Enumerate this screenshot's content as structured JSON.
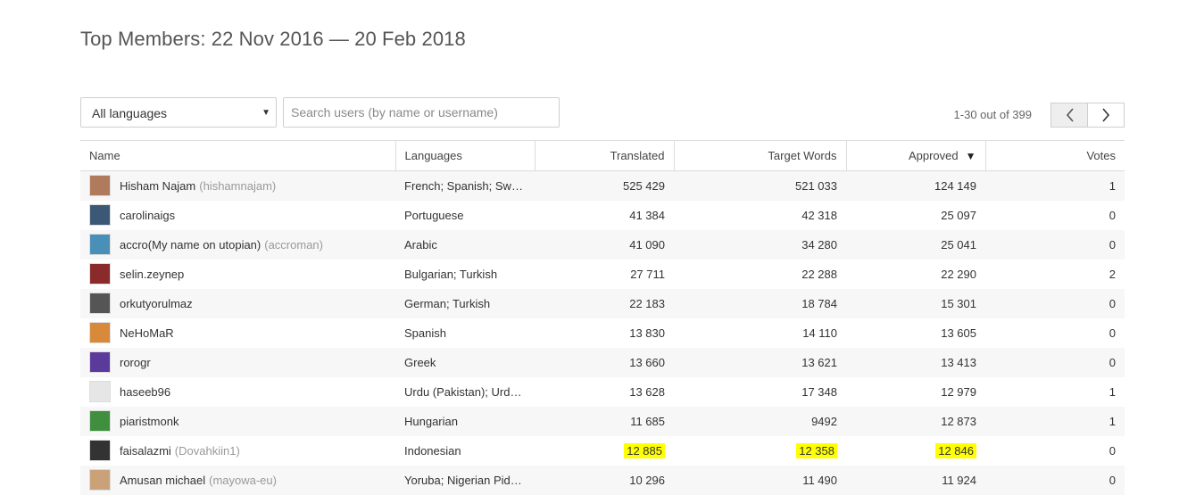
{
  "page": {
    "title": "Top Members: 22 Nov 2016 — 20 Feb 2018"
  },
  "filters": {
    "language_select_value": "All languages",
    "search_placeholder": "Search users (by name or username)"
  },
  "pagination": {
    "count_text": "1-30 out of 399"
  },
  "table": {
    "headers": {
      "name": "Name",
      "languages": "Languages",
      "translated": "Translated",
      "target_words": "Target Words",
      "approved": "Approved",
      "votes": "Votes"
    },
    "sort_indicator": "▼",
    "rows": [
      {
        "name": "Hisham Najam",
        "username": "(hishamnajam)",
        "languages": "French; Spanish; Sw…",
        "translated": "525 429",
        "target_words": "521 033",
        "approved": "124 149",
        "votes": "1",
        "avatar_color": "#b07a5c"
      },
      {
        "name": "carolinaigs",
        "username": "",
        "languages": "Portuguese",
        "translated": "41 384",
        "target_words": "42 318",
        "approved": "25 097",
        "votes": "0",
        "avatar_color": "#3b5876"
      },
      {
        "name": "accro(My name on utopian)",
        "username": "(accroman)",
        "languages": "Arabic",
        "translated": "41 090",
        "target_words": "34 280",
        "approved": "25 041",
        "votes": "0",
        "avatar_color": "#4a8fb8"
      },
      {
        "name": "selin.zeynep",
        "username": "",
        "languages": "Bulgarian; Turkish",
        "translated": "27 711",
        "target_words": "22 288",
        "approved": "22 290",
        "votes": "2",
        "avatar_color": "#8a2a2a"
      },
      {
        "name": "orkutyorulmaz",
        "username": "",
        "languages": "German; Turkish",
        "translated": "22 183",
        "target_words": "18 784",
        "approved": "15 301",
        "votes": "0",
        "avatar_color": "#555555"
      },
      {
        "name": "NeHoMaR",
        "username": "",
        "languages": "Spanish",
        "translated": "13 830",
        "target_words": "14 110",
        "approved": "13 605",
        "votes": "0",
        "avatar_color": "#d88a3a"
      },
      {
        "name": "rorogr",
        "username": "",
        "languages": "Greek",
        "translated": "13 660",
        "target_words": "13 621",
        "approved": "13 413",
        "votes": "0",
        "avatar_color": "#5a3a9a"
      },
      {
        "name": "haseeb96",
        "username": "",
        "languages": "Urdu (Pakistan); Urd…",
        "translated": "13 628",
        "target_words": "17 348",
        "approved": "12 979",
        "votes": "1",
        "avatar_color": "#e6e6e6"
      },
      {
        "name": "piaristmonk",
        "username": "",
        "languages": "Hungarian",
        "translated": "11 685",
        "target_words": "9492",
        "approved": "12 873",
        "votes": "1",
        "avatar_color": "#3f8f3f"
      },
      {
        "name": "faisalazmi",
        "username": "(Dovahkiin1)",
        "languages": "Indonesian",
        "translated": "12 885",
        "target_words": "12 358",
        "approved": "12 846",
        "votes": "0",
        "avatar_color": "#333333",
        "highlight": true
      },
      {
        "name": "Amusan michael",
        "username": "(mayowa-eu)",
        "languages": "Yoruba; Nigerian Pid…",
        "translated": "10 296",
        "target_words": "11 490",
        "approved": "11 924",
        "votes": "0",
        "avatar_color": "#c9a27a"
      }
    ]
  },
  "colors": {
    "highlight": "#ffff00",
    "row_stripe": "#f7f7f7",
    "border": "#dcdcdc"
  }
}
